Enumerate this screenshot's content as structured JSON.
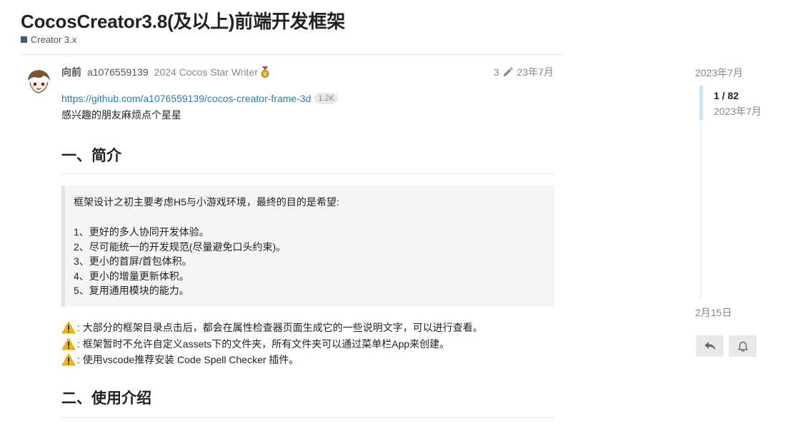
{
  "topic": {
    "title": "CocosCreator3.8(及以上)前端开发框架",
    "category": "Creator 3.x",
    "category_color": "#3d5a80"
  },
  "post": {
    "username": "向前",
    "fullname": "a1076559139",
    "user_title": "2024 Cocos Star Writer",
    "badge_icon": "medal-icon",
    "edit_count": "3",
    "date": "23年7月",
    "link_text": "https://github.com/a1076559139/cocos-creator-frame-3d",
    "link_clicks": "1.2K",
    "thanks_text": "感兴趣的朋友麻烦点个星星",
    "heading_intro": "一、简介",
    "quote": {
      "intro": "框架设计之初主要考虑H5与小游戏环境，最终的目的是希望:",
      "goals": [
        "1、更好的多人协同开发体验。",
        "2、尽可能统一的开发规范(尽量避免口头约束)。",
        "3、更小的首屏/首包体积。",
        "4、更小的增量更新体积。",
        "5、复用通用模块的能力。"
      ]
    },
    "warnings": [
      ": 大部分的框架目录点击后，都会在属性检查器页面生成它的一些说明文字，可以进行查看。",
      ": 框架暂时不允许自定义assets下的文件夹，所有文件夹可以通过菜单栏App来创建。",
      ": 使用vscode推荐安装 Code Spell Checker 插件。"
    ],
    "heading_usage": "二、使用介绍"
  },
  "timeline": {
    "start_date": "2023年7月",
    "position": "1 / 82",
    "position_date": "2023年7月",
    "end_date": "2月15日"
  },
  "colors": {
    "link": "#2c7bb6",
    "muted": "#888888",
    "warning": "#f5b400",
    "timeline_handle": "#c8e4f5"
  },
  "icons": {
    "edit": "pencil-icon",
    "warning": "warning-icon",
    "reply": "reply-icon",
    "notify": "bell-icon"
  }
}
